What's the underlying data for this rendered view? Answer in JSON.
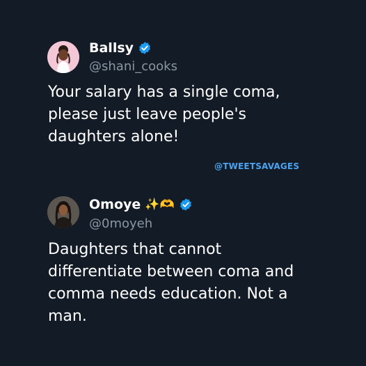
{
  "tweet1": {
    "display_name": "Ballsy",
    "handle": "@shani_cooks",
    "text_lines": [
      "Your salary has a single coma,",
      "please just leave people's",
      "daughters alone!"
    ]
  },
  "watermark": "@TWEETSAVAGES",
  "tweet2": {
    "display_name": "Omoye",
    "emoji": "✨🫶",
    "handle": "@0moyeh",
    "text_lines": [
      "Daughters that cannot",
      "differentiate between coma and",
      "comma needs education. Not a",
      "man."
    ]
  },
  "colors": {
    "background": "#131b26",
    "verified_badge": "#1d9bf0",
    "handle": "#8b96a3",
    "watermark": "#4aa3f0"
  },
  "icons": {
    "verified": "verified-badge-icon"
  }
}
